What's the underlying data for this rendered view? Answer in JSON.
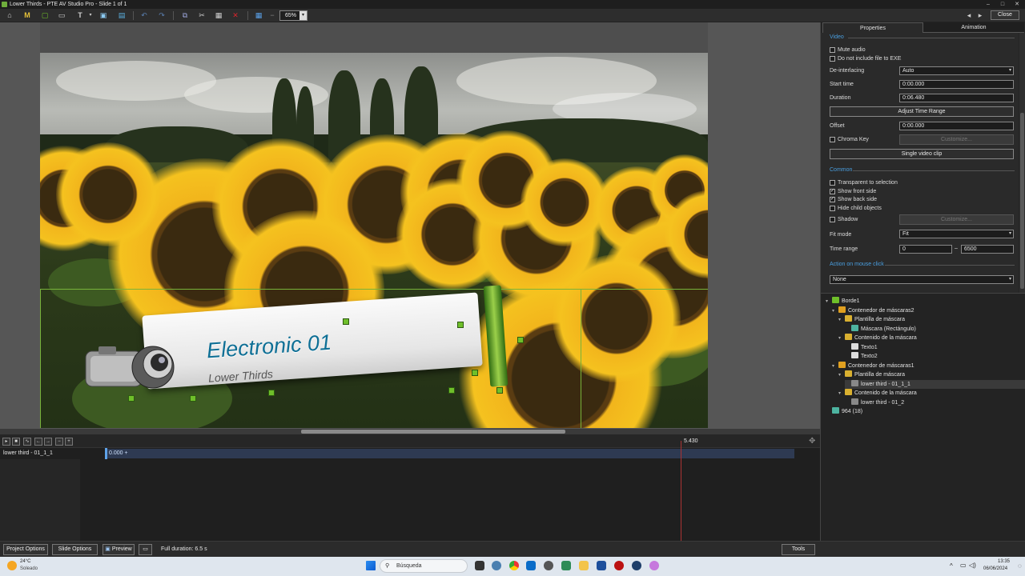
{
  "window": {
    "title": "Lower Thirds - PTE AV Studio Pro - Slide 1 of 1",
    "close_label": "Close",
    "prev": "◂",
    "next": "▸"
  },
  "toolbar": {
    "zoom": "65%",
    "m_label": "M",
    "t_label": "T"
  },
  "slide_text": {
    "title": "Electronic 01",
    "subtitle": "Lower Thirds"
  },
  "panel": {
    "tabs": [
      "Properties",
      "Animation"
    ],
    "sections": {
      "video": "Video",
      "common": "Common",
      "action": "Action on mouse click"
    },
    "checkboxes": [
      {
        "label": "Mute audio",
        "checked": false
      },
      {
        "label": "Do not include file to EXE",
        "checked": false
      },
      {
        "label": "Chroma Key",
        "checked": false
      },
      {
        "label": "Transparent to selection",
        "checked": false
      },
      {
        "label": "Show front side",
        "checked": true
      },
      {
        "label": "Show back side",
        "checked": true
      },
      {
        "label": "Hide child objects",
        "checked": false
      },
      {
        "label": "Shadow",
        "checked": false
      }
    ],
    "fields": {
      "deinterlacing_label": "De-interlacing",
      "deinterlacing_value": "Auto",
      "start_label": "Start time",
      "start_value": "0:00.000",
      "duration_label": "Duration",
      "duration_value": "0:06.480",
      "offset_label": "Offset",
      "offset_value": "0:00.000",
      "fit_label": "Fit mode",
      "fit_value": "Fit",
      "range_label": "Time range",
      "range_from": "0",
      "range_dash": "–",
      "range_to": "6500",
      "action_value": "None"
    },
    "buttons": {
      "adjust": "Adjust Time Range",
      "customize1": "Customize...",
      "single": "Single video clip",
      "customize2": "Customize..."
    }
  },
  "tree": [
    {
      "label": "Borde1",
      "exp": "▾",
      "icon": "frame-icon"
    },
    {
      "label": "Contenedor de máscaras2",
      "exp": "▾",
      "icon": "mask-container-icon"
    },
    {
      "label": "Plantilla de máscara",
      "exp": "▾",
      "icon": "mask-template-icon"
    },
    {
      "label": "Máscara (Rectángulo)",
      "exp": "",
      "icon": "image-icon"
    },
    {
      "label": "Contenido de la máscara",
      "exp": "▾",
      "icon": "mask-content-icon"
    },
    {
      "label": "Texto1",
      "exp": "",
      "icon": "text-icon"
    },
    {
      "label": "Texto2",
      "exp": "",
      "icon": "text-icon"
    },
    {
      "label": "Contenedor de máscaras1",
      "exp": "▾",
      "icon": "mask-container-icon"
    },
    {
      "label": "Plantilla de máscara",
      "exp": "▾",
      "icon": "mask-template-icon"
    },
    {
      "label": "lower third - 01_1_1",
      "exp": "",
      "icon": "video-icon"
    },
    {
      "label": "Contenido de la máscara",
      "exp": "▾",
      "icon": "mask-content-icon"
    },
    {
      "label": "lower third - 01_2",
      "exp": "",
      "icon": "video-icon"
    },
    {
      "label": "964 (18)",
      "exp": "",
      "icon": "image-icon"
    }
  ],
  "timeline": {
    "marker": "5.430",
    "track_label": "lower third - 01_1_1",
    "clip_start": "0.000 +"
  },
  "bottombar": {
    "project_options": "Project Options",
    "slide_options": "Slide Options",
    "preview": "Preview",
    "full_duration": "Full duration: 6.5 s",
    "tools": "Tools"
  },
  "taskbar": {
    "temp": "24°C",
    "weather": "Soleado",
    "search": "Búsqueda",
    "time": "13:35",
    "date": "06/06/2024"
  },
  "colors": {
    "accent": "#4a9fe0",
    "arrow": "#d9242c",
    "selection": "#78b33a"
  }
}
